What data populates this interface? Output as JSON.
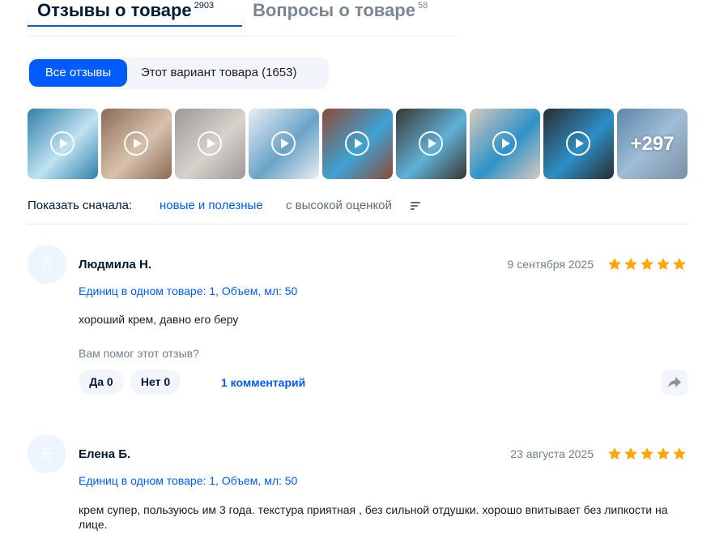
{
  "tabs": [
    {
      "label": "Отзывы о товаре",
      "count": "2903"
    },
    {
      "label": "Вопросы о товаре",
      "count": "58"
    }
  ],
  "filters": {
    "all": "Все отзывы",
    "variant": "Этот вариант товара (1653)"
  },
  "media": {
    "more_label": "+297",
    "thumbnails": [
      {
        "icon": "play-icon",
        "colors": [
          "#2f7fa8",
          "#bfe3f2"
        ]
      },
      {
        "icon": "play-icon",
        "colors": [
          "#8a6a55",
          "#d8c2ad"
        ]
      },
      {
        "icon": "play-icon",
        "colors": [
          "#9c9a96",
          "#d6d3cd"
        ]
      },
      {
        "icon": "play-icon",
        "colors": [
          "#e9eef2",
          "#6aa3c8"
        ]
      },
      {
        "icon": "play-icon",
        "colors": [
          "#8c4a33",
          "#3fa3d6"
        ]
      },
      {
        "icon": "play-icon",
        "colors": [
          "#3a3632",
          "#5fb1d6"
        ]
      },
      {
        "icon": "play-icon",
        "colors": [
          "#d7c9bc",
          "#2f93c8"
        ]
      },
      {
        "icon": "play-icon",
        "colors": [
          "#2a2c30",
          "#2d8fc6"
        ]
      }
    ]
  },
  "sort": {
    "label": "Показать сначала:",
    "option1": "новые и полезные",
    "option2": "с высокой оценкой"
  },
  "reviews": [
    {
      "initial": "Л",
      "author": "Людмила Н.",
      "date": "9 сентября 2025",
      "rating": 5,
      "variant": "Единиц в одном товаре: 1, Объем, мл: 50",
      "text": "хороший крем, давно его беру",
      "helped": "Вам помог этот отзыв?",
      "yes": "Да 0",
      "no": "Нет 0",
      "comments": "1 комментарий"
    },
    {
      "initial": "Е",
      "author": "Елена Б.",
      "date": "23 августа 2025",
      "rating": 5,
      "variant": "Единиц в одном товаре: 1, Объем, мл: 50",
      "text": "крем супер, пользуюсь им 3 года. текстура приятная , без сильной отдушки. хорошо впитывает без липкости на лице."
    }
  ],
  "colors": {
    "accent": "#005bff",
    "star": "#ffa800",
    "muted": "#707f8d"
  }
}
